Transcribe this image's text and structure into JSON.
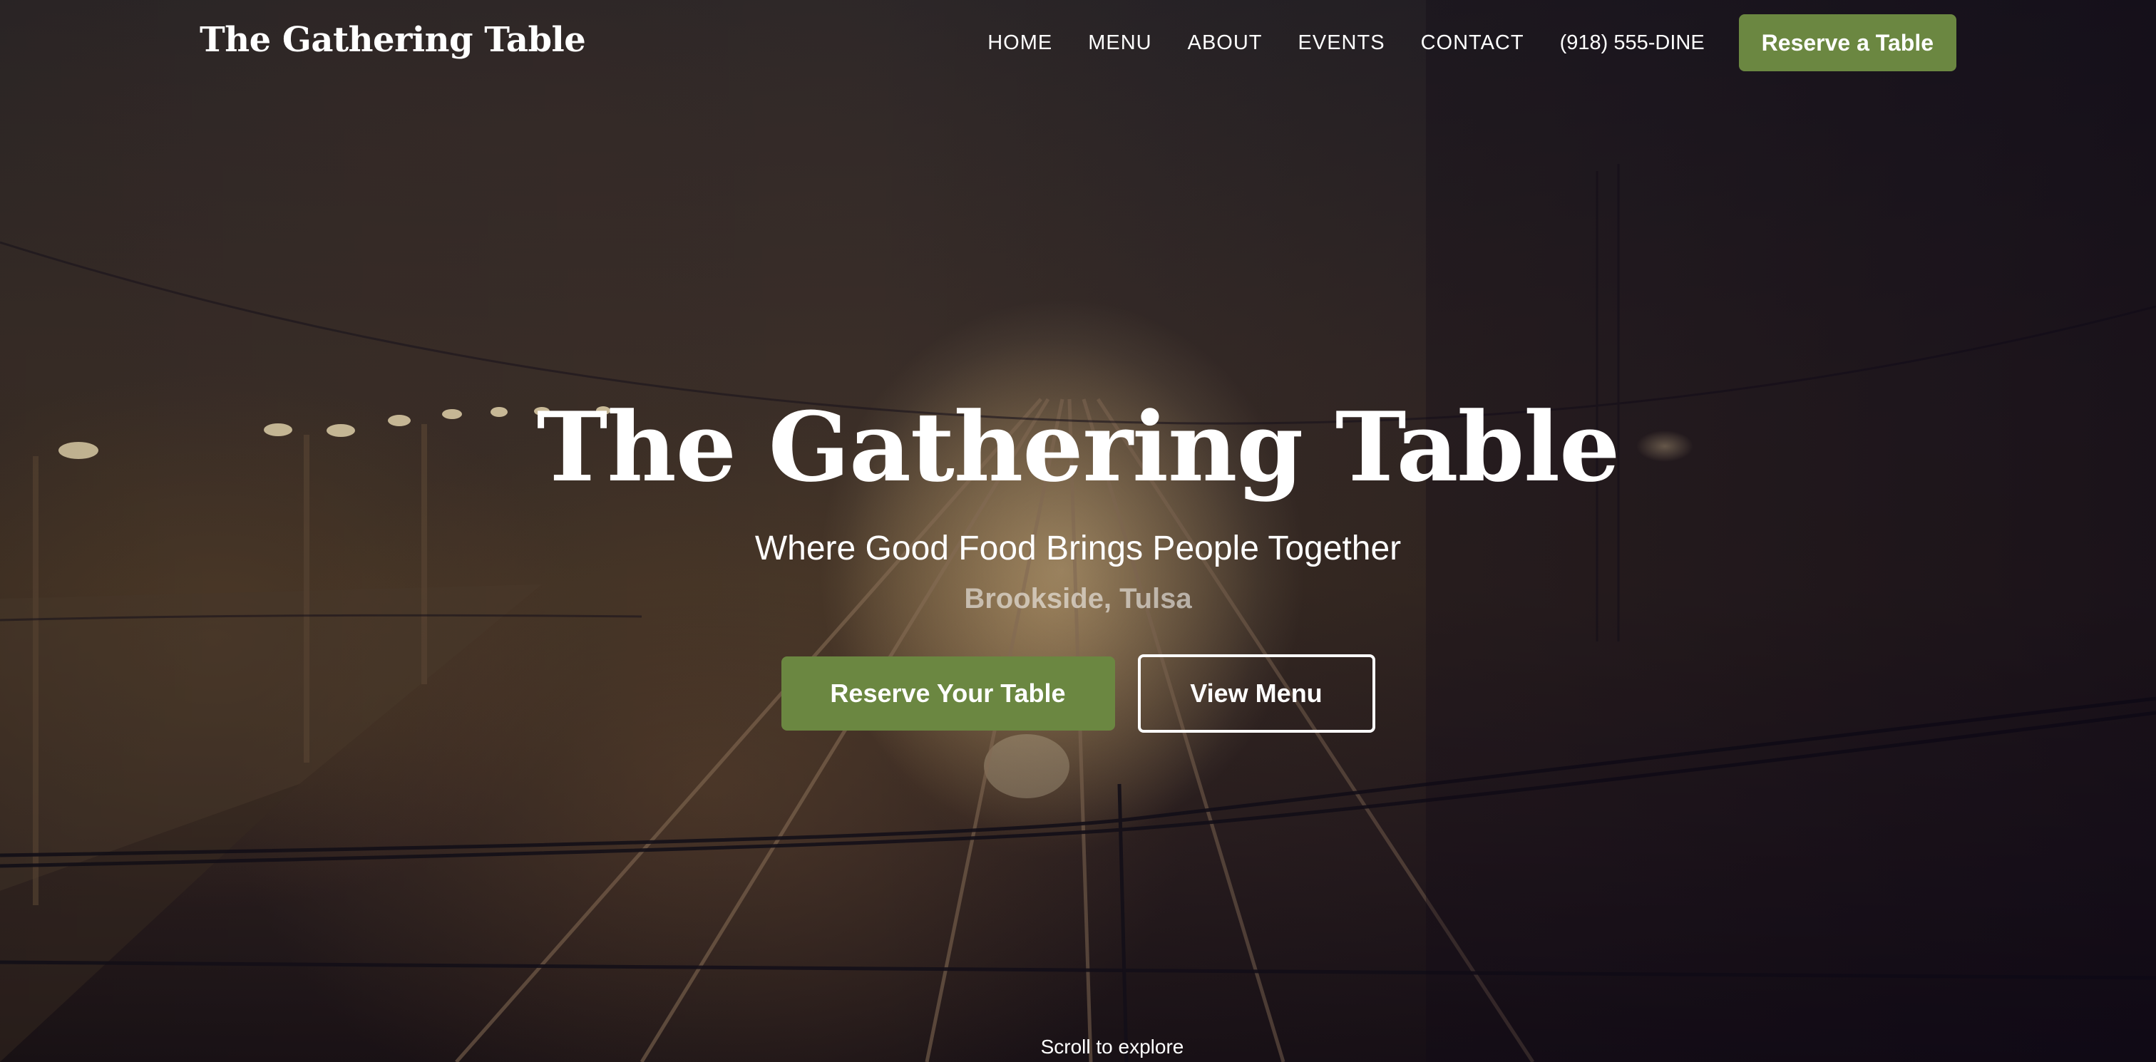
{
  "nav": {
    "brand": "The Gathering Table",
    "links": [
      "HOME",
      "MENU",
      "ABOUT",
      "EVENTS",
      "CONTACT"
    ],
    "phone": "(918) 555-DINE",
    "cta": "Reserve a Table"
  },
  "hero": {
    "title": "The Gathering Table",
    "tagline": "Where Good Food Brings People Together",
    "location": "Brookside, Tulsa",
    "primary_button": "Reserve Your Table",
    "secondary_button": "View Menu",
    "scroll_hint": "Scroll to explore"
  },
  "colors": {
    "accent": "#6b8741",
    "text": "#ffffff",
    "location_text": "rgba(255,255,255,0.55)"
  }
}
